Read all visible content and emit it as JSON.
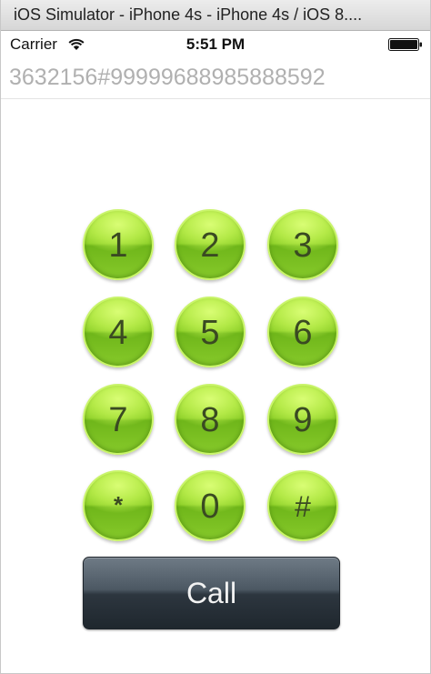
{
  "window": {
    "title": "iOS Simulator - iPhone 4s - iPhone 4s / iOS 8...."
  },
  "status_bar": {
    "carrier": "Carrier",
    "time": "5:51 PM",
    "wifi_icon": "wifi-icon",
    "battery_icon": "battery-icon"
  },
  "dialer": {
    "number": "3632156#99999688985888592",
    "keys": [
      {
        "label": "1"
      },
      {
        "label": "2"
      },
      {
        "label": "3"
      },
      {
        "label": "4"
      },
      {
        "label": "5"
      },
      {
        "label": "6"
      },
      {
        "label": "7"
      },
      {
        "label": "8"
      },
      {
        "label": "9"
      },
      {
        "label": "*"
      },
      {
        "label": "0"
      },
      {
        "label": "#"
      }
    ],
    "call_label": "Call"
  },
  "colors": {
    "key_green": "#8fd12a",
    "key_text": "#3a4a22",
    "call_dark": "#2d363f",
    "number_gray": "#b0b0b0"
  }
}
